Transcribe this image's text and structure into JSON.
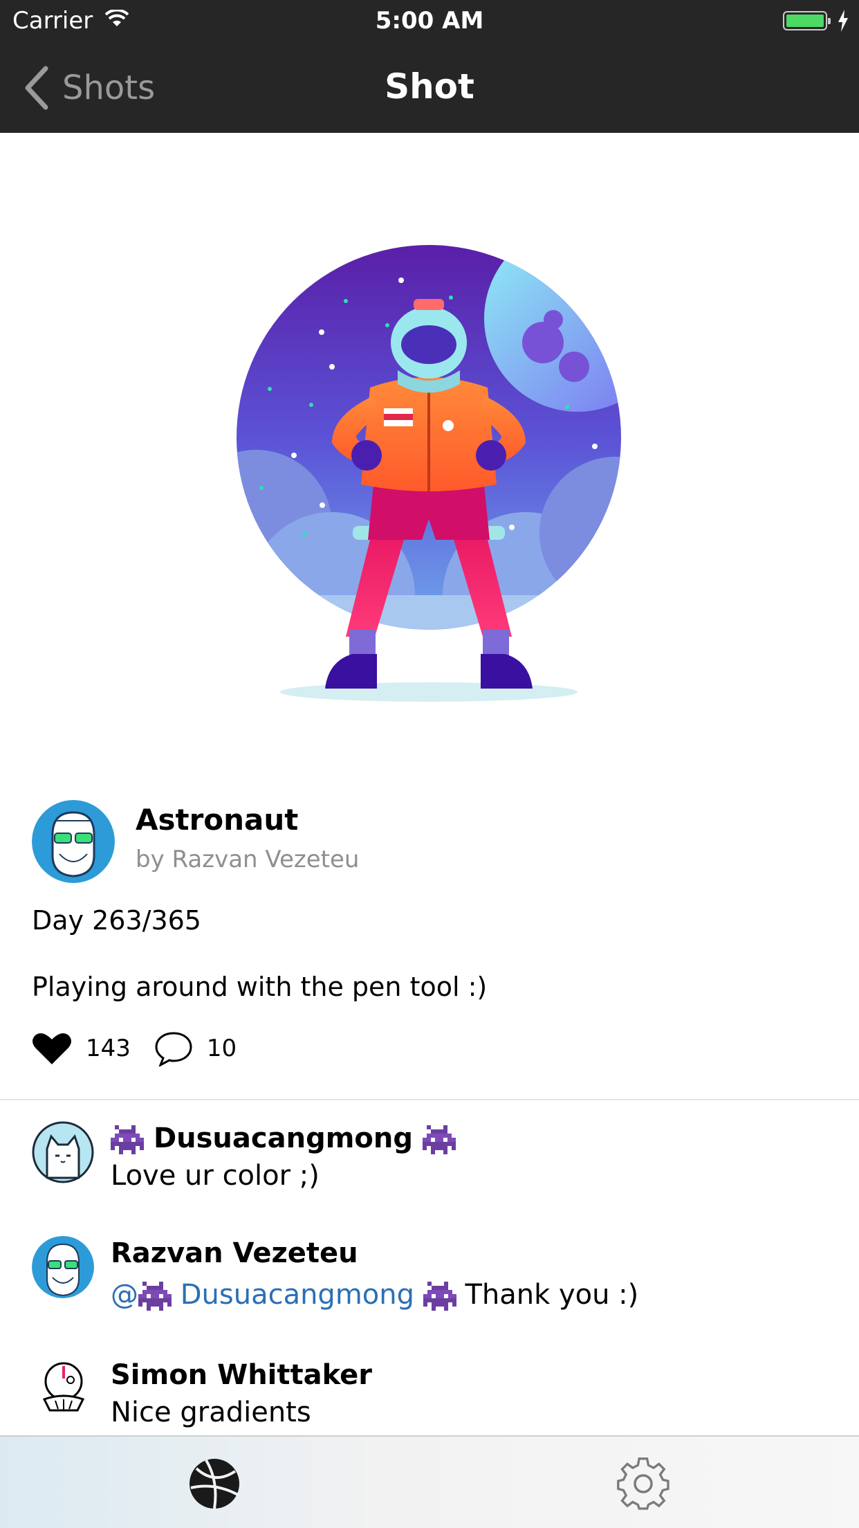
{
  "status_bar": {
    "carrier": "Carrier",
    "time": "5:00 AM",
    "battery_color": "#4cd964"
  },
  "nav": {
    "back_label": "Shots",
    "title": "Shot",
    "bar_color": "#262626"
  },
  "shot": {
    "title": "Astronaut",
    "author": "by Razvan Vezeteu",
    "description": [
      "Day 263/365",
      "Playing around with the pen tool :)"
    ],
    "likes": "143",
    "comments": "10",
    "illustration": "astronaut-illustration"
  },
  "comments": [
    {
      "author": "Dusuacangmong",
      "text": "Love ur color ;)",
      "avatar": "cat-avatar"
    },
    {
      "author": "Razvan Vezeteu",
      "mention": "@",
      "mention_name": "Dusuacangmong",
      "text": "Thank you :)",
      "avatar": "bearded-man-avatar"
    },
    {
      "author": "Simon Whittaker",
      "text": "Nice gradients",
      "avatar": "clown-avatar"
    }
  ],
  "tab_bar": {
    "tabs": [
      "dribbble-ball-icon",
      "gear-icon"
    ]
  },
  "colors": {
    "mention": "#2a6fb5",
    "muted": "#8e8e93",
    "divider": "#e6e6e6"
  }
}
